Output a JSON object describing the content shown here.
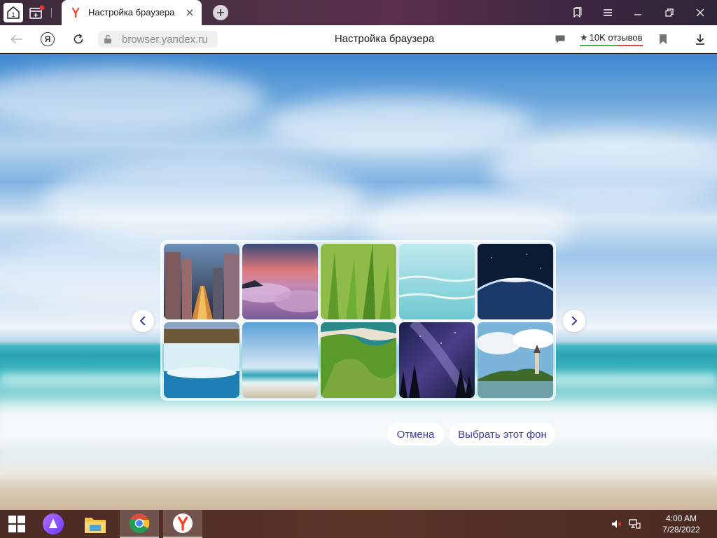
{
  "tabbar": {
    "home_badge": "1",
    "tab_title": "Настройка браузера",
    "tab_favicon": "yandex-y-icon"
  },
  "addressbar": {
    "url": "browser.yandex.ru",
    "page_title": "Настройка браузера",
    "reviews_label": "10K отзывов"
  },
  "picker": {
    "thumbnails": [
      {
        "subject": "city-night"
      },
      {
        "subject": "sunset-clouds"
      },
      {
        "subject": "green-grass"
      },
      {
        "subject": "turquoise-water"
      },
      {
        "subject": "earth-from-space"
      },
      {
        "subject": "waterfall"
      },
      {
        "subject": "sea-sky"
      },
      {
        "subject": "green-cliffs"
      },
      {
        "subject": "starry-sky"
      },
      {
        "subject": "lake-church"
      }
    ],
    "cancel_label": "Отмена",
    "choose_label": "Выбрать этот фон"
  },
  "taskbar": {
    "time": "4:00 AM",
    "date": "7/28/2022"
  },
  "colors": {
    "accent": "#3d3aa6",
    "yandex_red": "#fc3f1d",
    "alice_purple": "#8b5cf6"
  }
}
